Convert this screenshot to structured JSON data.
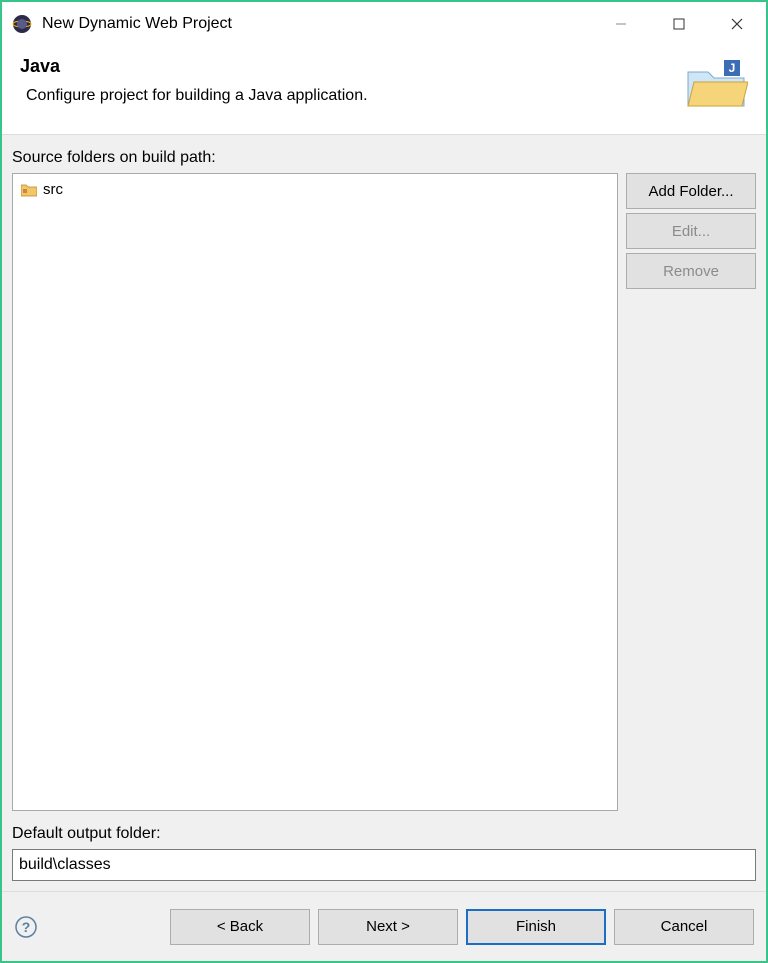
{
  "window": {
    "title": "New Dynamic Web Project"
  },
  "header": {
    "title": "Java",
    "subtitle": "Configure project for building a Java application."
  },
  "body": {
    "source_label": "Source folders on build path:",
    "items": [
      {
        "label": "src"
      }
    ],
    "buttons": {
      "add": "Add Folder...",
      "edit": "Edit...",
      "remove": "Remove"
    },
    "output_label": "Default output folder:",
    "output_value": "build\\classes"
  },
  "footer": {
    "back": "< Back",
    "next": "Next >",
    "finish": "Finish",
    "cancel": "Cancel"
  }
}
